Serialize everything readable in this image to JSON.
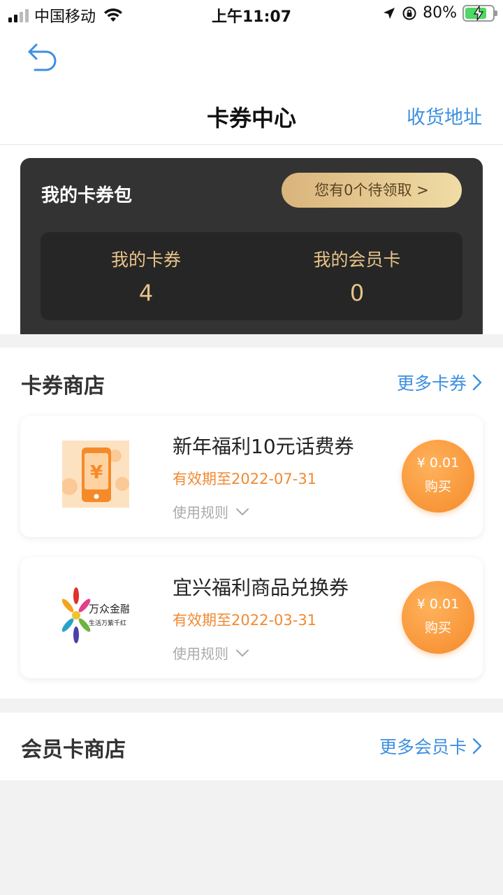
{
  "status_bar": {
    "carrier": "中国移动",
    "time": "上午11:07",
    "battery": "80%",
    "battery_level": 0.8
  },
  "nav": {
    "title": "卡券中心",
    "action": "收货地址",
    "back_icon": "back-arrow-icon"
  },
  "wallet": {
    "title": "我的卡券包",
    "pending_label": "您有0个待领取 >",
    "stats": [
      {
        "label": "我的卡券",
        "value": "4"
      },
      {
        "label": "我的会员卡",
        "value": "0"
      }
    ]
  },
  "coupon_shop": {
    "title": "卡券商店",
    "more": "更多卡券",
    "items": [
      {
        "name": "新年福利10元话费券",
        "valid": "有效期至2022-07-31",
        "rules": "使用规则",
        "price": "¥ 0.01",
        "buy": "购买",
        "image": "phone-yuan-icon"
      },
      {
        "name": "宜兴福利商品兑换券",
        "valid": "有效期至2022-03-31",
        "rules": "使用规则",
        "price": "¥ 0.01",
        "buy": "购买",
        "image": "wanzhong-jinrong-logo",
        "logo_title": "万众金融",
        "logo_sub": "生活万紫千红"
      }
    ]
  },
  "member_shop": {
    "title": "会员卡商店",
    "more": "更多会员卡"
  },
  "colors": {
    "accent_blue": "#3d8fe0",
    "gold": "#e8c489",
    "orange": "#f58a2a",
    "wallet_bg": "#333333"
  }
}
